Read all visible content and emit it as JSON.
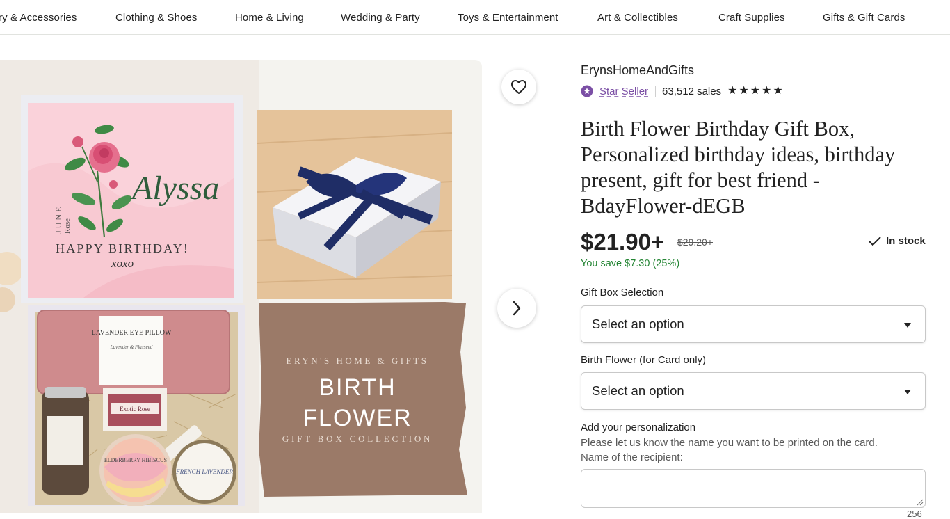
{
  "nav": {
    "categories": [
      "ry & Accessories",
      "Clothing & Shoes",
      "Home & Living",
      "Wedding & Party",
      "Toys & Entertainment",
      "Art & Collectibles",
      "Craft Supplies",
      "Gifts & Gift Cards"
    ]
  },
  "gallery": {
    "card": {
      "name": "Alyssa",
      "month": "JUNE",
      "flower": "Rose",
      "greeting": "HAPPY BIRTHDAY!",
      "xoxo": "xoxo"
    },
    "products": {
      "pillow_title": "LAVENDER EYE PILLOW",
      "pillow_sub": "Lavender & Flaxseed",
      "soap_label": "Exotic Rose",
      "candle1": "ELDERBERRY HIBISCUS",
      "candle2": "FRENCH LAVENDER"
    },
    "banner": {
      "brand": "ERYN'S HOME & GIFTS",
      "line1": "BIRTH",
      "line2": "FLOWER",
      "sub": "GIFT BOX COLLECTION"
    },
    "fav_icon": "heart-icon",
    "next_icon": "chevron-right-icon"
  },
  "listing": {
    "shop_name": "ErynsHomeAndGifts",
    "star_seller_label": "Star Seller",
    "sales": "63,512 sales",
    "rating": 5,
    "title": "Birth Flower Birthday Gift Box, Personalized birthday ideas, birthday present, gift for best friend - BdayFlower-dEGB",
    "price": "$21.90+",
    "original_price": "$29.20+",
    "stock": "In stock",
    "savings": "You save $7.30 (25%)",
    "gift_box_label": "Gift Box Selection",
    "gift_box_value": "Select an option",
    "birth_flower_label": "Birth Flower (for Card only)",
    "birth_flower_value": "Select an option",
    "personalization_label": "Add your personalization",
    "personalization_help_1": "Please let us know the name you want to be printed on the card.",
    "personalization_help_2": "Name of the recipient:",
    "char_counter": "256"
  },
  "colors": {
    "accent_purple": "#7b4fa5",
    "savings_green": "#258635",
    "ribbon_navy": "#1f2d66",
    "card_pink": "#f7c6cf",
    "kraft_brown": "#9b7a68"
  }
}
